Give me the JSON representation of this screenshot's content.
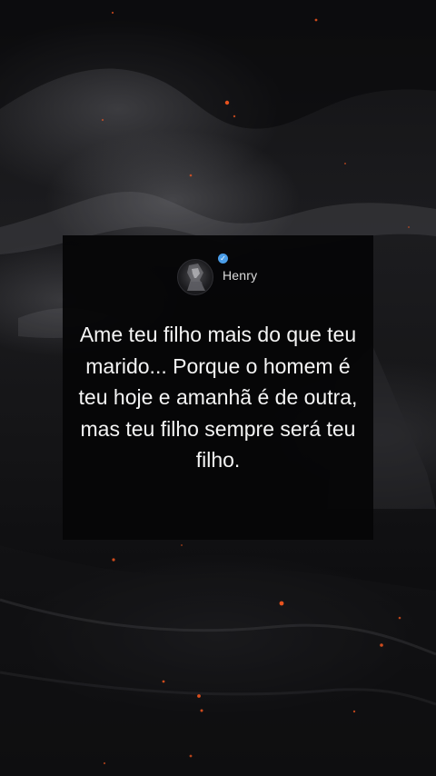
{
  "post": {
    "username": "Henry",
    "verified_icon": "verified-badge-icon",
    "verified_color": "#4a9de8",
    "quote": "Ame teu filho mais do que teu marido... Porque o homem é teu hoje e amanhã é de outra, mas teu filho sempre será teu filho."
  },
  "background": {
    "description_icon": "dark-storm-clouds-with-embers",
    "ember_color": "#ff5a1f"
  }
}
